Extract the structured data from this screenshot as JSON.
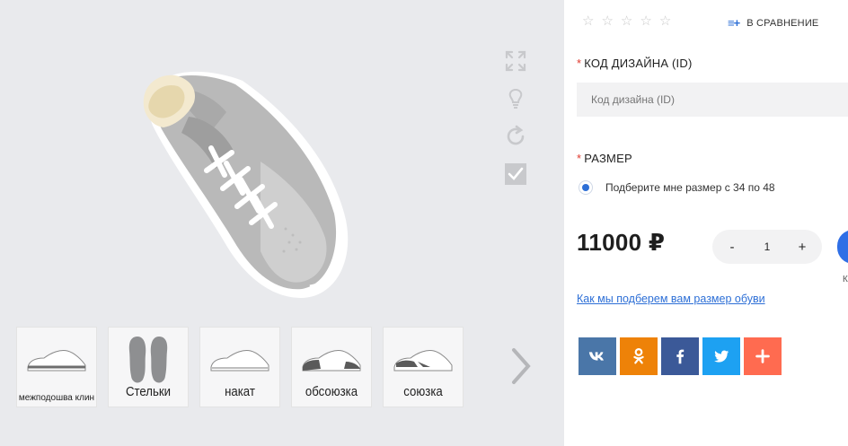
{
  "rating": {
    "stars_total": 5,
    "stars_filled": 0,
    "star_glyph": "☆"
  },
  "compare": {
    "icon": "≡+",
    "label": "В СРАВНЕНИЕ"
  },
  "design_field": {
    "label": "КОД ДИЗАЙНА (ID)",
    "required_mark": "*",
    "placeholder": "Код дизайна (ID)"
  },
  "size_field": {
    "label": "РАЗМЕР",
    "required_mark": "*",
    "option_label": "Подберите мне размер с 34 по 48",
    "selected": true
  },
  "price": {
    "value": "11000 ₽"
  },
  "quantity": {
    "minus": "-",
    "value": "1",
    "plus": "+"
  },
  "buy": {
    "sub_label": "К"
  },
  "size_help_link": "Как мы подберем вам размер обуви",
  "thumbnails": [
    {
      "label": "межподошва клин",
      "icon": "sneaker-side"
    },
    {
      "label": "Стельки",
      "icon": "insoles"
    },
    {
      "label": "накат",
      "icon": "sneaker-side"
    },
    {
      "label": "обсоюзка",
      "icon": "sneaker-side-dark-toe"
    },
    {
      "label": "союзка",
      "icon": "sneaker-side-dark-vamp"
    }
  ],
  "viewer_tools": [
    "fullscreen-icon",
    "lightbulb-icon",
    "rotate-icon",
    "checkbox-icon"
  ],
  "share_buttons": [
    {
      "name": "vk",
      "color": "#4a76a8"
    },
    {
      "name": "odnoklassniki",
      "color": "#ee8208"
    },
    {
      "name": "facebook",
      "color": "#3b5998"
    },
    {
      "name": "twitter",
      "color": "#1da1f2"
    },
    {
      "name": "more",
      "color": "#ff6b50"
    }
  ],
  "colors": {
    "accent": "#2d6fd6",
    "required": "#e03a2f",
    "viewer_bg": "#e9eaed"
  }
}
